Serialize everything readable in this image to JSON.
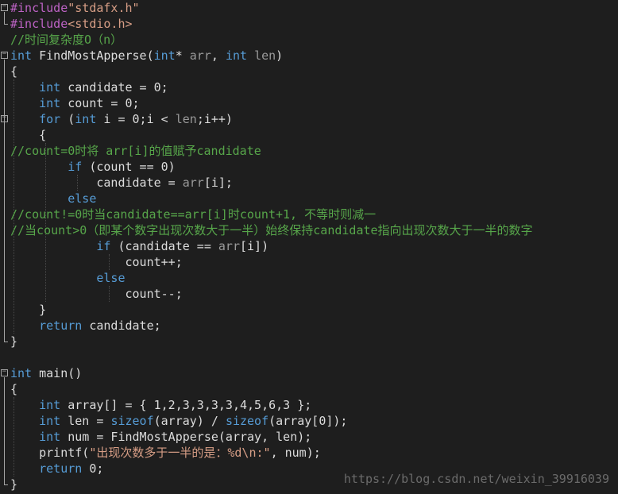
{
  "code": {
    "lines": [
      [
        [
          "macro",
          "#include"
        ],
        [
          "str",
          "\"stdafx.h\""
        ]
      ],
      [
        [
          "macro",
          "#include"
        ],
        [
          "str",
          "<stdio.h>"
        ]
      ],
      [
        [
          "cmt",
          "//时间复杂度O（n）"
        ]
      ],
      [
        [
          "kw",
          "int"
        ],
        [
          "txt",
          " FindMostApperse("
        ],
        [
          "kw",
          "int"
        ],
        [
          "txt",
          "* "
        ],
        [
          "param",
          "arr"
        ],
        [
          "txt",
          ", "
        ],
        [
          "kw",
          "int"
        ],
        [
          "txt",
          " "
        ],
        [
          "param",
          "len"
        ],
        [
          "txt",
          ")"
        ]
      ],
      [
        [
          "txt",
          "{"
        ]
      ],
      [
        [
          "txt",
          "    "
        ],
        [
          "kw",
          "int"
        ],
        [
          "txt",
          " candidate = 0;"
        ]
      ],
      [
        [
          "txt",
          "    "
        ],
        [
          "kw",
          "int"
        ],
        [
          "txt",
          " count = 0;"
        ]
      ],
      [
        [
          "txt",
          "    "
        ],
        [
          "kw",
          "for"
        ],
        [
          "txt",
          " ("
        ],
        [
          "kw",
          "int"
        ],
        [
          "txt",
          " i = 0;i < "
        ],
        [
          "param",
          "len"
        ],
        [
          "txt",
          ";i++)"
        ]
      ],
      [
        [
          "txt",
          "    {"
        ]
      ],
      [
        [
          "cmt",
          "//count=0时将 arr[i]的值赋予candidate"
        ]
      ],
      [
        [
          "txt",
          "        "
        ],
        [
          "kw",
          "if"
        ],
        [
          "txt",
          " (count == 0)"
        ]
      ],
      [
        [
          "txt",
          "            candidate = "
        ],
        [
          "param",
          "arr"
        ],
        [
          "txt",
          "[i];"
        ]
      ],
      [
        [
          "txt",
          "        "
        ],
        [
          "kw",
          "else"
        ]
      ],
      [
        [
          "cmt",
          "//count!=0时当candidate==arr[i]时count+1, 不等时则减一"
        ]
      ],
      [
        [
          "cmt",
          "//当count>0（即某个数字出现次数大于一半）始终保持candidate指向出现次数大于一半的数字"
        ]
      ],
      [
        [
          "txt",
          "            "
        ],
        [
          "kw",
          "if"
        ],
        [
          "txt",
          " (candidate == "
        ],
        [
          "param",
          "arr"
        ],
        [
          "txt",
          "[i])"
        ]
      ],
      [
        [
          "txt",
          "                count++;"
        ]
      ],
      [
        [
          "txt",
          "            "
        ],
        [
          "kw",
          "else"
        ]
      ],
      [
        [
          "txt",
          "                count--;"
        ]
      ],
      [
        [
          "txt",
          "    }"
        ]
      ],
      [
        [
          "txt",
          "    "
        ],
        [
          "kw",
          "return"
        ],
        [
          "txt",
          " candidate;"
        ]
      ],
      [
        [
          "txt",
          "}"
        ]
      ],
      [
        [
          "txt",
          ""
        ]
      ],
      [
        [
          "kw",
          "int"
        ],
        [
          "txt",
          " main()"
        ]
      ],
      [
        [
          "txt",
          "{"
        ]
      ],
      [
        [
          "txt",
          "    "
        ],
        [
          "kw",
          "int"
        ],
        [
          "txt",
          " array[] = { 1,2,3,3,3,3,4,5,6,3 };"
        ]
      ],
      [
        [
          "txt",
          "    "
        ],
        [
          "kw",
          "int"
        ],
        [
          "txt",
          " len = "
        ],
        [
          "kw",
          "sizeof"
        ],
        [
          "txt",
          "(array) / "
        ],
        [
          "kw",
          "sizeof"
        ],
        [
          "txt",
          "(array[0]);"
        ]
      ],
      [
        [
          "txt",
          "    "
        ],
        [
          "kw",
          "int"
        ],
        [
          "txt",
          " num = FindMostApperse(array, len);"
        ]
      ],
      [
        [
          "txt",
          "    printf("
        ],
        [
          "str",
          "\"出现次数多于一半的是：%d\\n:\""
        ],
        [
          "txt",
          ", num);"
        ]
      ],
      [
        [
          "txt",
          "    "
        ],
        [
          "kw",
          "return"
        ],
        [
          "txt",
          " 0;"
        ]
      ],
      [
        [
          "txt",
          "}"
        ]
      ]
    ]
  },
  "watermark": "https://blog.csdn.net/weixin_39916039",
  "colors": {
    "background": "#1e1e1e",
    "keyword": "#569cd6",
    "string": "#d69d85",
    "comment": "#57a64a",
    "parameter": "#9a9a9a",
    "text": "#dcdcdc"
  }
}
